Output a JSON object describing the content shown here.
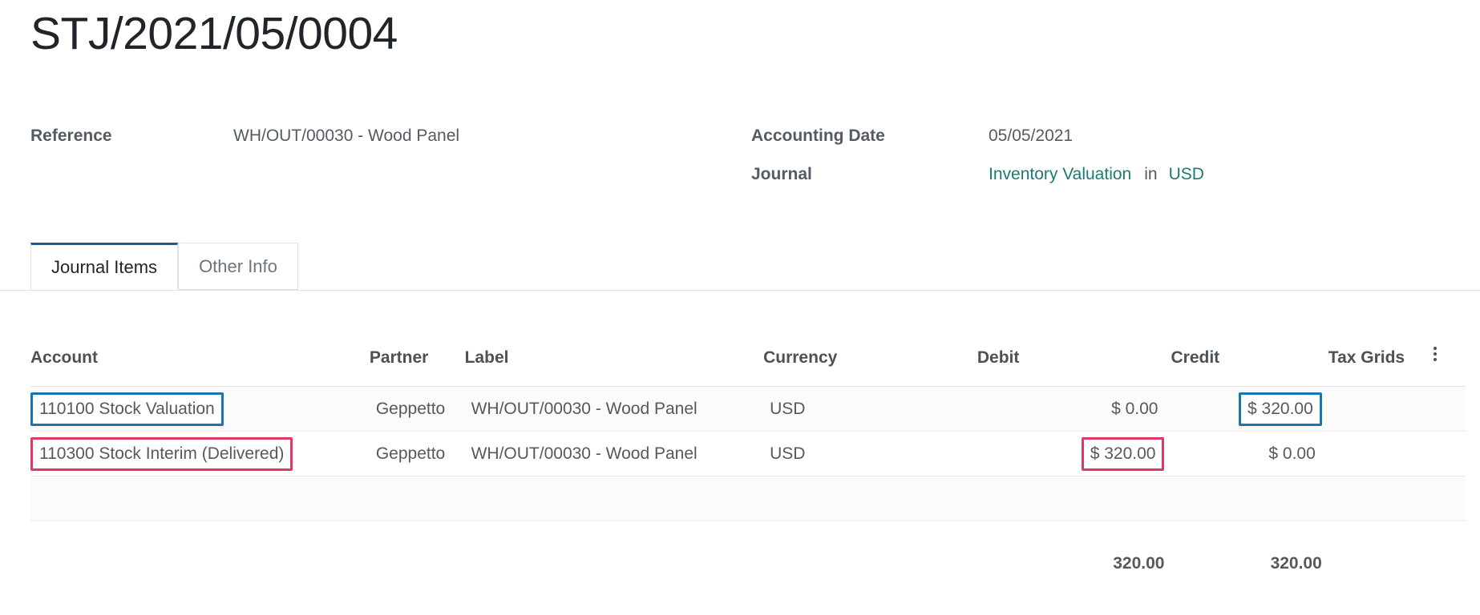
{
  "record": {
    "title": "STJ/2021/05/0004"
  },
  "fields": {
    "reference": {
      "label": "Reference",
      "value": "WH/OUT/00030 - Wood Panel"
    },
    "accounting_date": {
      "label": "Accounting Date",
      "value": "05/05/2021"
    },
    "journal": {
      "label": "Journal",
      "value": "Inventory Valuation",
      "separator": "in",
      "currency": "USD"
    }
  },
  "tabs": [
    {
      "id": "journal-items",
      "label": "Journal Items",
      "active": true
    },
    {
      "id": "other-info",
      "label": "Other Info",
      "active": false
    }
  ],
  "table": {
    "headers": {
      "account": "Account",
      "partner": "Partner",
      "label": "Label",
      "currency": "Currency",
      "debit": "Debit",
      "credit": "Credit",
      "tax_grids": "Tax Grids",
      "options_icon": "kebab-menu-icon"
    },
    "rows": [
      {
        "account": "110100 Stock Valuation",
        "partner": "Geppetto",
        "label": "WH/OUT/00030 - Wood Panel",
        "currency": "USD",
        "debit": "$ 0.00",
        "credit": "$ 320.00",
        "tax_grids": "",
        "highlight_account": "blue",
        "highlight_credit": "blue"
      },
      {
        "account": "110300 Stock Interim (Delivered)",
        "partner": "Geppetto",
        "label": "WH/OUT/00030 - Wood Panel",
        "currency": "USD",
        "debit": "$ 320.00",
        "credit": "$ 0.00",
        "tax_grids": "",
        "highlight_account": "pink",
        "highlight_debit": "pink"
      }
    ],
    "totals": {
      "debit": "320.00",
      "credit": "320.00"
    }
  },
  "colors": {
    "link": "#1d7a73",
    "tab_active_underline": "#1a5c8f",
    "highlight_blue": "#1a74b0",
    "highlight_pink": "#e03a63"
  }
}
